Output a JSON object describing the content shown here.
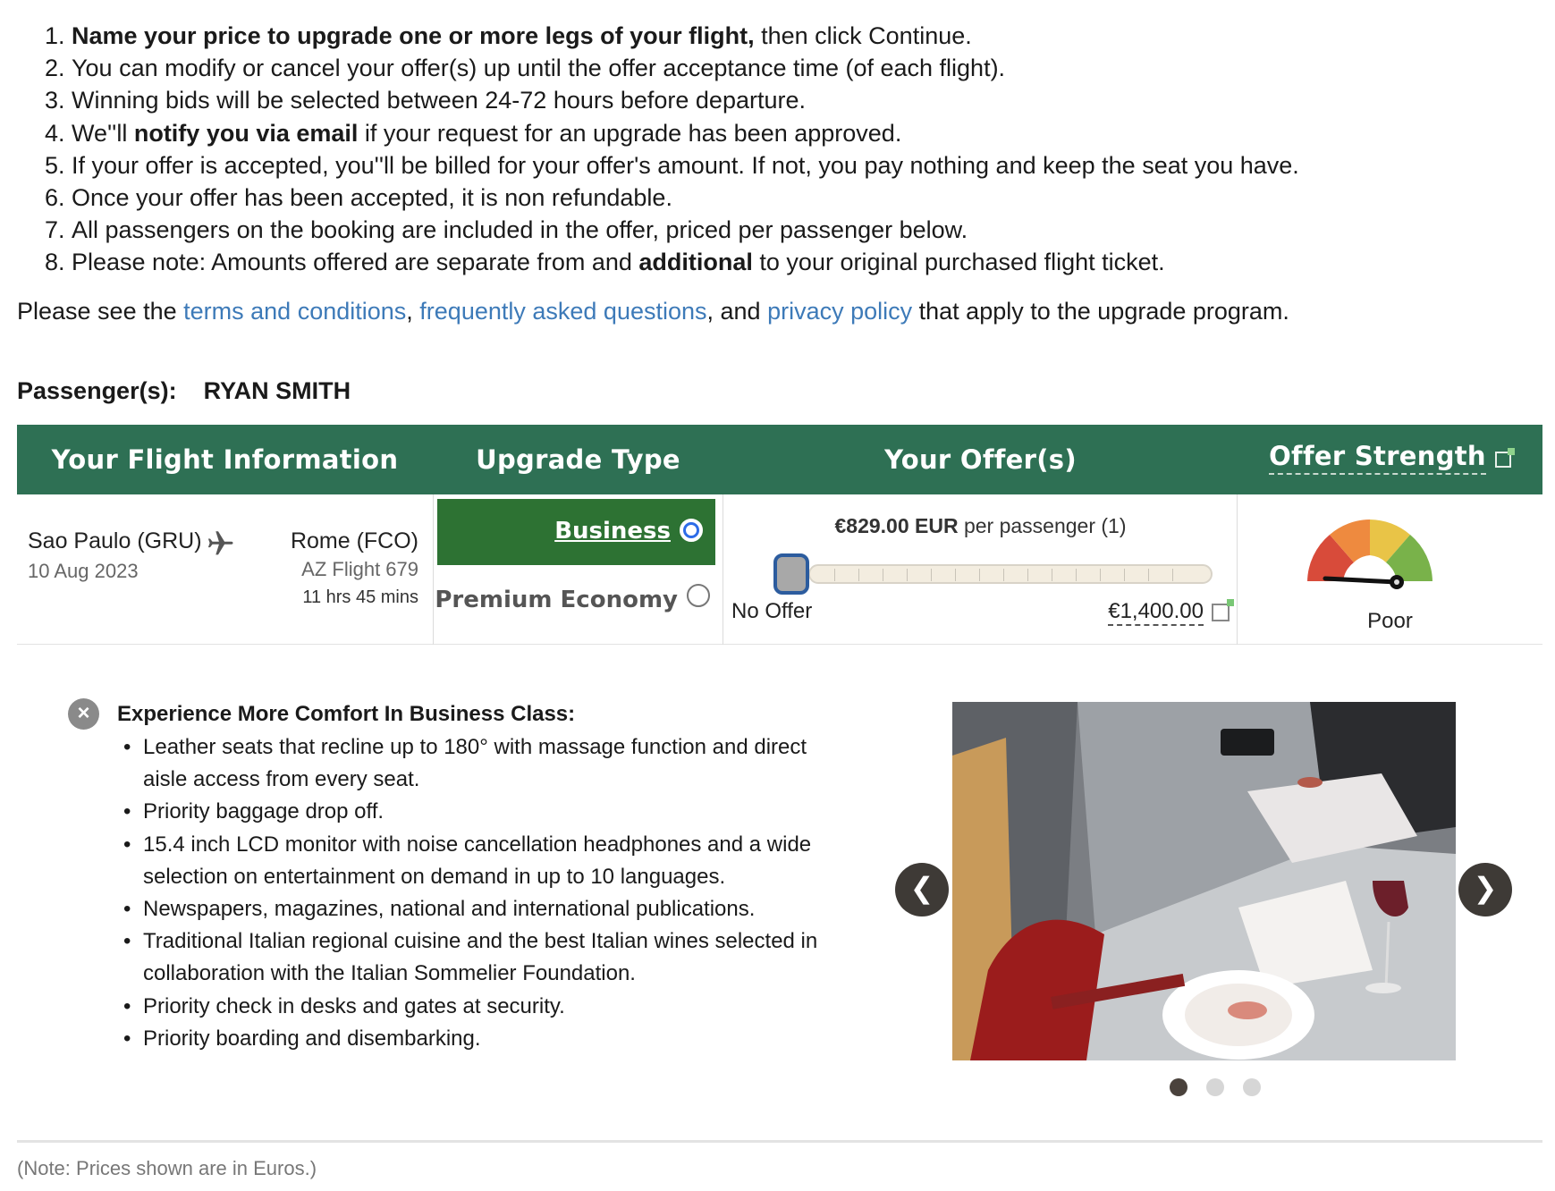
{
  "instructions": [
    {
      "num": "1.",
      "bold": "Name your price to upgrade one or more legs of your flight,",
      "after": " then click Continue."
    },
    {
      "num": "2.",
      "text": "You can modify or cancel your offer(s) up until the offer acceptance time (of each flight)."
    },
    {
      "num": "3.",
      "text": "Winning bids will be selected between 24-72 hours before departure."
    },
    {
      "num": "4.",
      "before": "We''ll ",
      "bold": "notify you via email",
      "after": " if your request for an upgrade has been approved."
    },
    {
      "num": "5.",
      "text": "If your offer is accepted, you''ll be billed for your offer's amount. If not, you pay nothing and keep the seat you have."
    },
    {
      "num": "6.",
      "text": "Once your offer has been accepted, it is non refundable."
    },
    {
      "num": "7.",
      "text": "All passengers on the booking are included in the offer, priced per passenger below."
    },
    {
      "num": "8.",
      "before": "Please note: Amounts offered are separate from and ",
      "bold": "additional",
      "after": " to your original purchased flight ticket."
    }
  ],
  "terms": {
    "prefix": "Please see the ",
    "link1": "terms and conditions",
    "sep1": ", ",
    "link2": "frequently asked questions",
    "sep2": ", and ",
    "link3": "privacy policy",
    "suffix": " that apply to the upgrade program."
  },
  "passenger": {
    "label": "Passenger(s):",
    "name": "RYAN SMITH"
  },
  "table_head": {
    "flight": "Your Flight Information",
    "upgrade": "Upgrade Type",
    "offer": "Your Offer(s)",
    "strength": "Offer Strength"
  },
  "flight": {
    "origin": "Sao Paulo (GRU)",
    "date": "10 Aug 2023",
    "destination": "Rome (FCO)",
    "flight_no": "AZ Flight 679",
    "duration": "11 hrs 45 mins"
  },
  "upgrade": {
    "options": [
      {
        "label": "Business",
        "selected": true
      },
      {
        "label": "Premium Economy",
        "selected": false
      }
    ]
  },
  "offer": {
    "amount": "€829.00 EUR",
    "per": " per passenger (1)",
    "min_label": "No Offer",
    "max_label": "€1,400.00",
    "slider_position": 0
  },
  "strength": {
    "label": "Poor",
    "level": 0.15
  },
  "features": {
    "title": "Experience More Comfort In Business Class:",
    "items": [
      "Leather seats that recline up to 180° with massage function and direct aisle access from every seat.",
      "Priority baggage drop off.",
      "15.4 inch LCD monitor with noise cancellation headphones and a wide selection on entertainment on demand in up to 10 languages.",
      "Newspapers, magazines, national and international publications.",
      "Traditional Italian regional cuisine and the best Italian wines selected in collaboration with the Italian Sommelier Foundation.",
      "Priority check in desks and gates at security.",
      "Priority boarding and disembarking."
    ]
  },
  "carousel": {
    "prev": "❮",
    "next": "❯",
    "active_index": 0,
    "count": 3
  },
  "note": "(Note: Prices shown are in Euros.)",
  "icons": {
    "plane": "plane-icon",
    "close": "close-icon",
    "info": "info-icon",
    "edit": "edit-icon"
  },
  "colors": {
    "header_green": "#2e7054",
    "selected_green": "#2d7233",
    "link_blue": "#3d7ab8"
  }
}
